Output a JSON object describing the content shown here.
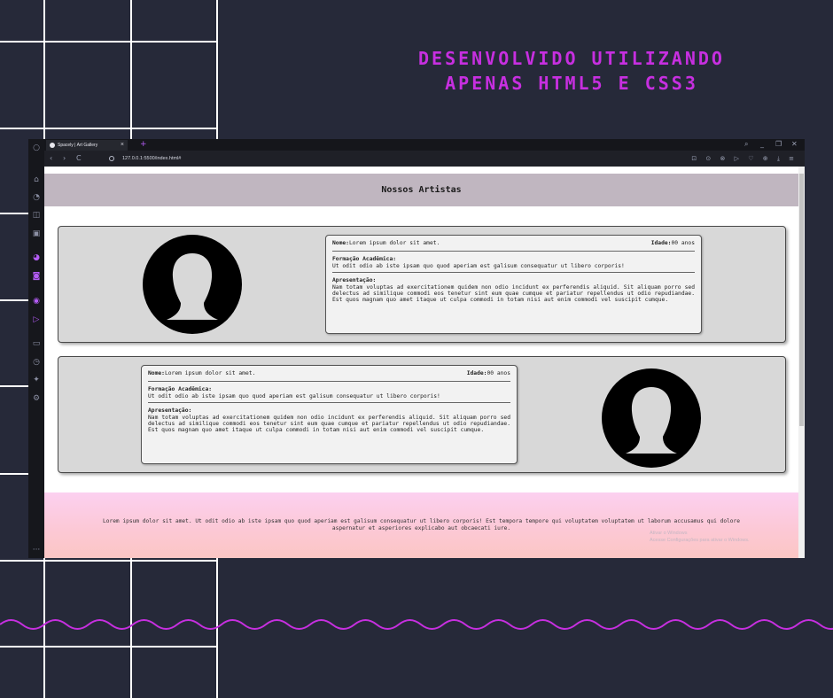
{
  "poster": {
    "headline_line1": "DESENVOLVIDO UTILIZANDO",
    "headline_line2": "APENAS HTML5 E CSS3",
    "accent_color": "#c72fe0",
    "background_color": "#262939"
  },
  "browser": {
    "tab_title": "Spacely | Art Gallery",
    "tab_close": "×",
    "new_tab": "+",
    "url": "127.0.0.1:5500/index.html#",
    "nav": {
      "back": "‹",
      "forward": "›",
      "reload": "C"
    },
    "window_controls": {
      "search": "⌕",
      "minimize": "_",
      "restore": "❐",
      "close": "✕"
    },
    "toolbar_icons": "⊡ ⊙ ⊗ ▷ ♡ ⊕ ⤓ ≡",
    "sidebar_icons": [
      "opera-icon",
      "gamepad-icon",
      "speedometer-icon",
      "shopping-bag-icon",
      "tv-icon",
      "messenger-icon",
      "instagram-icon",
      "music-player-icon",
      "send-icon",
      "chat-icon",
      "history-icon",
      "extensions-icon",
      "settings-icon"
    ],
    "more": "···"
  },
  "page": {
    "header_title": "Nossos Artistas",
    "artists": [
      {
        "name_label": "Nome:",
        "name": "Lorem ipsum dolor sit amet.",
        "age_label": "Idade:",
        "age": "00 anos",
        "formacao_label": "Formação Acadêmica:",
        "formacao": "Ut odit odio ab iste ipsam quo quod aperiam est galisum consequatur ut libero corporis!",
        "apresentacao_label": "Apresentação:",
        "apresentacao": "Nam totam voluptas ad exercitationem quidem non odio incidunt ex perferendis aliquid. Sit aliquam porro sed delectus ad similique commodi eos tenetur sint eum quae cumque et pariatur repellendus ut odio repudiandae. Est quos magnam quo amet itaque ut culpa commodi in totam nisi aut enim commodi vel suscipit cumque."
      },
      {
        "name_label": "Nome:",
        "name": "Lorem ipsum dolor sit amet.",
        "age_label": "Idade:",
        "age": "00 anos",
        "formacao_label": "Formação Acadêmica:",
        "formacao": "Ut odit odio ab iste ipsam quo quod aperiam est galisum consequatur ut libero corporis!",
        "apresentacao_label": "Apresentação:",
        "apresentacao": "Nam totam voluptas ad exercitationem quidem non odio incidunt ex perferendis aliquid. Sit aliquam porro sed delectus ad similique commodi eos tenetur sint eum quae cumque et pariatur repellendus ut odio repudiandae. Est quos magnam quo amet itaque ut culpa commodi in totam nisi aut enim commodi vel suscipit cumque."
      }
    ],
    "footer_text": "Lorem ipsum dolor sit amet. Ut odit odio ab iste ipsam quo quod aperiam est galisum consequatur ut libero corporis! Est tempora tempore qui voluptatem voluptatem ut laborum accusamus qui dolore aspernatur et asperiores explicabo aut obcaecati iure.",
    "watermark_line1": "Ativar o Windows",
    "watermark_line2": "Acesse Configurações para ativar o Windows."
  }
}
